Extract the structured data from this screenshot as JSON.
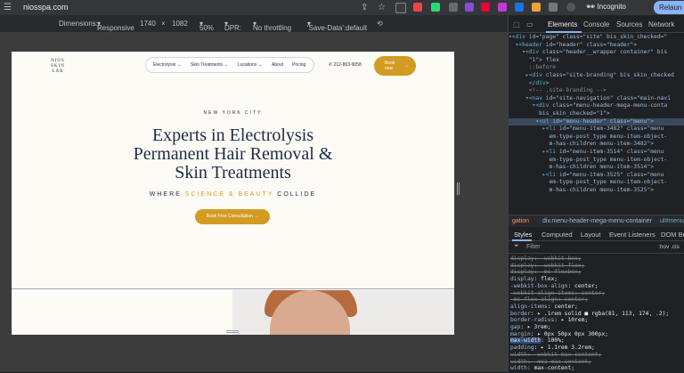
{
  "browser": {
    "url": "niosspa.com",
    "incognito_label": "Incognito",
    "relaunch_label": "Relaun"
  },
  "device_toolbar": {
    "dimensions_label": "Dimensions:",
    "dimensions_value": "Responsive",
    "width": "1740",
    "times": "×",
    "height": "1082",
    "zoom": "50%",
    "dpr_label": "DPR:",
    "throttle": "No throttling",
    "save_data": "'Save-Data':default"
  },
  "site": {
    "logo_lines": [
      "NIOS",
      "SKIN",
      "LAB"
    ],
    "nav": [
      {
        "label": "Electrolysis",
        "chevron": true
      },
      {
        "label": "Skin Treatments",
        "chevron": true
      },
      {
        "label": "Locations",
        "chevron": true
      },
      {
        "label": "About",
        "chevron": false
      },
      {
        "label": "Pricing",
        "chevron": false
      }
    ],
    "phone": "212-863-9058",
    "book_line1": "Book",
    "book_line2": "now",
    "book_arrow": "→",
    "city": "NEW YORK CITY",
    "headline": [
      "Experts in Electrolysis",
      "Permanent Hair Removal &",
      "Skin Treatments"
    ],
    "tagline_pre": "WHERE ",
    "tagline_accent": "SCIENCE & BEAUTY",
    "tagline_post": " COLLIDE",
    "consult_label": "Book Free Consultation",
    "consult_arrow": "→"
  },
  "devtools": {
    "tabs": [
      "Elements",
      "Console",
      "Sources",
      "Network"
    ],
    "active_tab": "Elements",
    "elements": [
      {
        "pre": "▾<",
        "tag": "div",
        "rest": " id=\"page\" class=\"site\" bis_skin_checked=\""
      },
      {
        "pre": "  ▾<",
        "tag": "header",
        "rest": " id=\"header\" class=\"header\">"
      },
      {
        "pre": "    ▾<",
        "tag": "div",
        "rest": " class=\"header__wrapper container\" bis"
      },
      {
        "pre": "      ",
        "tag": "",
        "rest": "\"1\"> flex"
      },
      {
        "pre": "      ::before",
        "tag": "",
        "rest": ""
      },
      {
        "pre": "     ▸<",
        "tag": "div",
        "rest": " class=\"site-branding\" bis_skin_checked"
      },
      {
        "pre": "      </",
        "tag": "div",
        "rest": ">"
      },
      {
        "pre": "      <!-- .site-branding -->",
        "tag": "",
        "rest": ""
      },
      {
        "pre": "     ▾<",
        "tag": "nav",
        "rest": " id=\"site-navigation\" class=\"main-navi"
      },
      {
        "pre": "       ▾<",
        "tag": "div",
        "rest": " class=\"menu-header-mega-menu-conta"
      },
      {
        "pre": "         ",
        "tag": "",
        "rest": "bis_skin_checked=\"1\">"
      },
      {
        "pre": "        ▾<",
        "tag": "ul",
        "rest": " id=\"menu-header\" class=\"menu\">"
      },
      {
        "pre": "          ▸<",
        "tag": "li",
        "rest": " id=\"menu-item-3482\" class=\"menu"
      },
      {
        "pre": "            ",
        "tag": "",
        "rest": "em-type-post_type menu-item-object-"
      },
      {
        "pre": "            ",
        "tag": "",
        "rest": "m-has-children menu-item-3482\">"
      },
      {
        "pre": "          ▸<",
        "tag": "li",
        "rest": " id=\"menu-item-3514\" class=\"menu"
      },
      {
        "pre": "            ",
        "tag": "",
        "rest": "em-type-post_type menu-item-object-"
      },
      {
        "pre": "            ",
        "tag": "",
        "rest": "m-has-children menu-item-3514\">"
      },
      {
        "pre": "          ▸<",
        "tag": "li",
        "rest": " id=\"menu-item-3525\" class=\"menu"
      },
      {
        "pre": "            ",
        "tag": "",
        "rest": "em-type-post_type menu-item-object-"
      },
      {
        "pre": "            ",
        "tag": "",
        "rest": "m-has-children menu-item-3525\">"
      }
    ],
    "breadcrumbs": [
      "gation",
      "div.menu-header-mega-menu-container",
      "ul#menu"
    ],
    "subtabs": [
      "Styles",
      "Computed",
      "Layout",
      "Event Listeners",
      "DOM Br"
    ],
    "filter_placeholder": "Filter",
    "filter_right": ":hov .cls",
    "styles": [
      {
        "prop": "display",
        "val": "-webkit-box;",
        "strike": true
      },
      {
        "prop": "display",
        "val": "-webkit-flex;",
        "strike": true
      },
      {
        "prop": "display",
        "val": "-ms-flexbox;",
        "strike": true
      },
      {
        "prop": "display",
        "val": "flex;",
        "strike": false
      },
      {
        "prop": "-webkit-box-align",
        "val": "center;",
        "strike": false
      },
      {
        "prop": "-webkit-align-items",
        "val": "center;",
        "strike": true
      },
      {
        "prop": "-ms-flex-align",
        "val": "center;",
        "strike": true
      },
      {
        "prop": "align-items",
        "val": "center;",
        "strike": false
      },
      {
        "prop": "border",
        "val": "▸ .1rem solid ■ rgba(81, 113, 174, .2);",
        "strike": false
      },
      {
        "prop": "border-radius",
        "val": "▸ 10rem;",
        "strike": false
      },
      {
        "prop": "gap",
        "val": "▸ 3rem;",
        "strike": false
      },
      {
        "prop": "margin",
        "val": "▸ 0px 50px 0px 300px;",
        "strike": false
      },
      {
        "prop": "max-width",
        "val": "100%;",
        "strike": false,
        "highlight": true
      },
      {
        "prop": "padding",
        "val": "▸ 1.1rem 3.2rem;",
        "strike": false
      },
      {
        "prop": "width",
        "val": "-webkit-max-content;",
        "strike": true
      },
      {
        "prop": "width",
        "val": "-moz-max-content;",
        "strike": true
      },
      {
        "prop": "width",
        "val": "max-content;",
        "strike": false
      }
    ]
  }
}
